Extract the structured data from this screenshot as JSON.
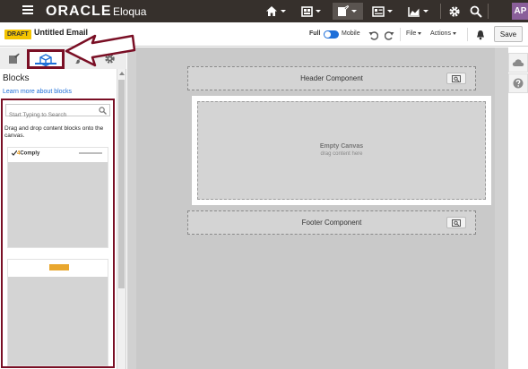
{
  "topnav": {
    "brand": "ORACLE",
    "product": "Eloqua",
    "menu_icon": "hamburger-icon",
    "items": [
      {
        "icon": "home-icon"
      },
      {
        "icon": "campaigns-icon"
      },
      {
        "icon": "assets-icon"
      },
      {
        "icon": "contacts-icon"
      },
      {
        "icon": "insight-icon"
      },
      {
        "icon": "settings-gear-icon"
      },
      {
        "icon": "search-icon"
      }
    ],
    "avatar": "AP"
  },
  "toolbar": {
    "status_badge": "DRAFT",
    "title": "Untitled Email",
    "view_full": "Full",
    "view_mobile": "Mobile",
    "file_menu": "File",
    "actions_menu": "Actions",
    "save_label": "Save"
  },
  "panel": {
    "tabs": [
      {
        "icon": "design-icon"
      },
      {
        "icon": "blocks-cube-icon",
        "active": true
      },
      {
        "icon": "brush-icon"
      },
      {
        "icon": "gear-icon"
      }
    ],
    "heading": "Blocks",
    "learn_link": "Learn more about blocks",
    "search_placeholder": "Start Typing to Search",
    "instruction": "Drag and drop content blocks onto the canvas.",
    "block1_logo_prefix": "4",
    "block1_logo_name": "Comply"
  },
  "canvas": {
    "header_component": "Header Component",
    "empty_title": "Empty Canvas",
    "empty_subtitle": "drag content here",
    "footer_component": "Footer Component"
  },
  "colors": {
    "topnav_bg": "#36302c",
    "accent_blue": "#1e6fd9",
    "highlight": "#7a0f25",
    "draft_badge": "#f4c400",
    "avatar": "#8a5f9a"
  }
}
